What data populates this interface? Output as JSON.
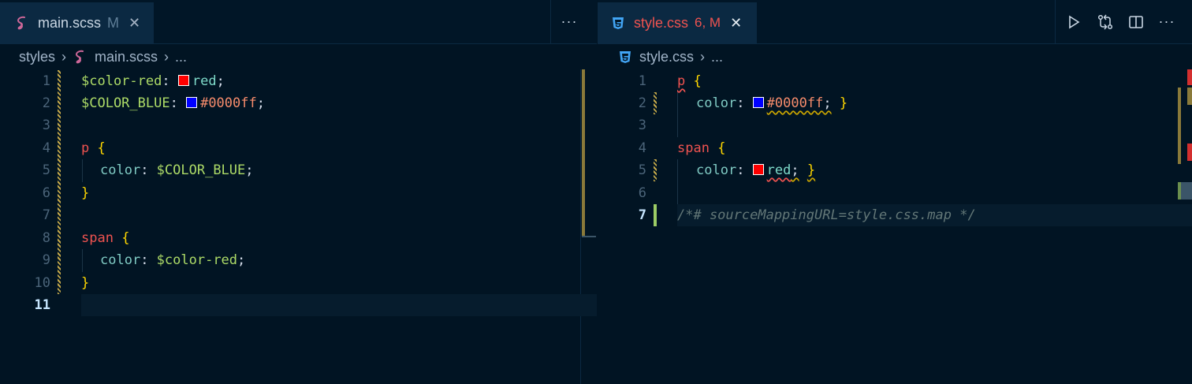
{
  "left_pane": {
    "tab": {
      "name": "main.scss",
      "status": "M",
      "icon": "sass-icon",
      "close": "✕"
    },
    "more": "···",
    "breadcrumb": {
      "folder": "styles",
      "file": "main.scss",
      "ellipsis": "..."
    },
    "line_numbers": [
      "1",
      "2",
      "3",
      "4",
      "5",
      "6",
      "7",
      "8",
      "9",
      "10",
      "11"
    ],
    "code": {
      "l1_var": "$color-red",
      "l1_colon": ": ",
      "l1_val": "red",
      "l1_semi": ";",
      "l2_var": "$COLOR_BLUE",
      "l2_colon": ": ",
      "l2_val": "#0000ff",
      "l2_semi": ";",
      "l4_sel": "p",
      "l4_brace": "{",
      "l5_prop": "color",
      "l5_colon": ": ",
      "l5_val": "$COLOR_BLUE",
      "l5_semi": ";",
      "l6_brace": "}",
      "l8_sel": "span",
      "l8_brace": "{",
      "l9_prop": "color",
      "l9_colon": ": ",
      "l9_val": "$color-red",
      "l9_semi": ";",
      "l10_brace": "}"
    }
  },
  "right_pane": {
    "tab": {
      "name": "style.css",
      "status": "6, M",
      "icon": "css3-icon",
      "close": "✕"
    },
    "actions": {
      "run": "▷",
      "compare": "⇄",
      "split": "▥",
      "more": "···"
    },
    "breadcrumb": {
      "file": "style.css",
      "ellipsis": "..."
    },
    "line_numbers": [
      "1",
      "2",
      "3",
      "4",
      "5",
      "6",
      "7"
    ],
    "code": {
      "l1_sel": "p",
      "l1_brace": "{",
      "l2_prop": "color",
      "l2_colon": ": ",
      "l2_val": "#0000ff",
      "l2_semi": ";",
      "l2_brace": "}",
      "l4_sel": "span",
      "l4_brace": "{",
      "l5_prop": "color",
      "l5_colon": ": ",
      "l5_val": "red",
      "l5_semi": ";",
      "l5_brace": "}",
      "l7_comment": "/*# sourceMappingURL=style.css.map */"
    }
  },
  "colors": {
    "swatch_red": "#ff0000",
    "swatch_blue": "#0000ff",
    "modified_gutter": "#c5a94a",
    "added_gutter": "#9ccc65",
    "error": "#ef5350"
  }
}
